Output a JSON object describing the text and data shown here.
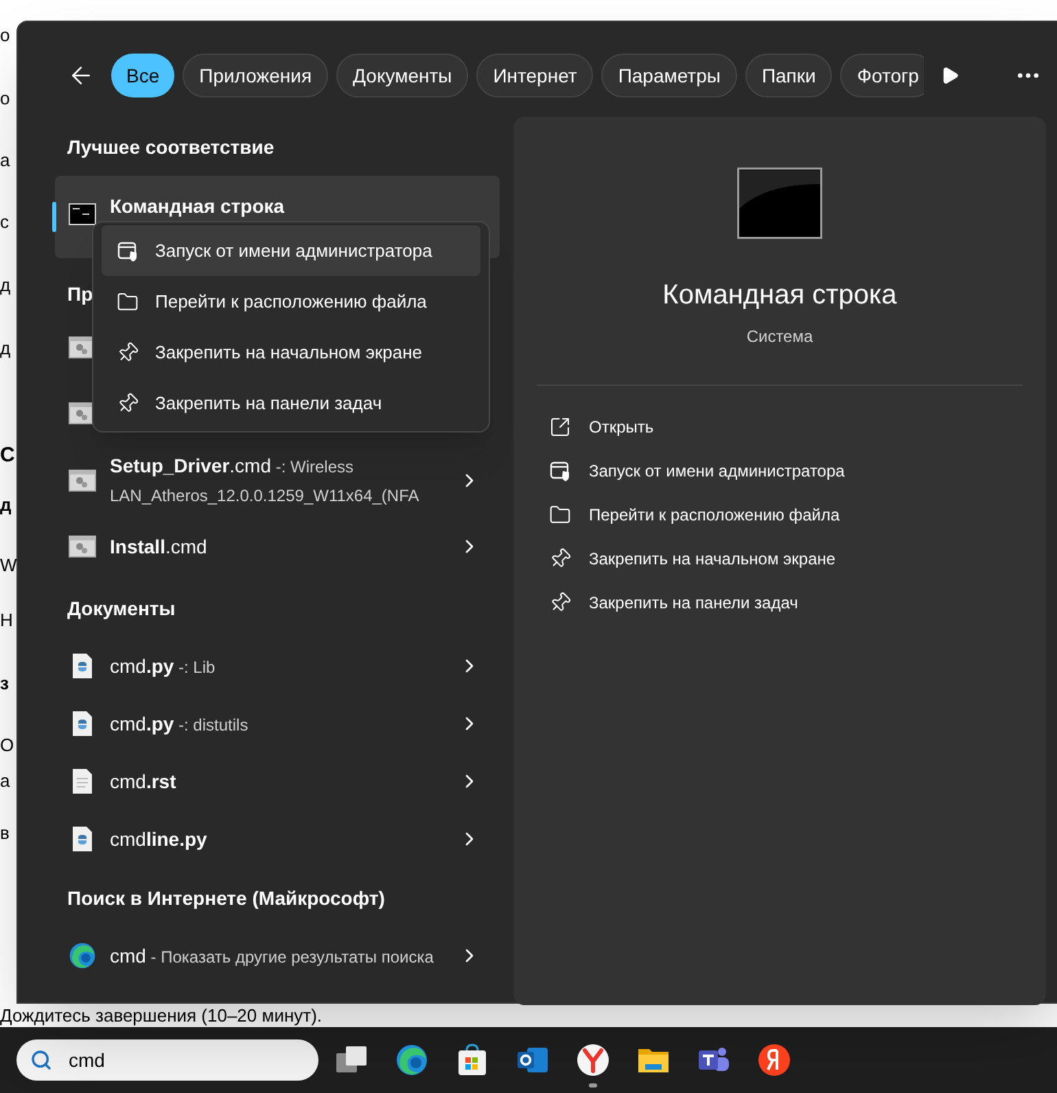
{
  "background_page": {
    "fragments": [
      {
        "text": "о",
        "kind": "plain"
      },
      {
        "text": "о",
        "kind": "plain"
      },
      {
        "text": "а",
        "kind": "plain"
      },
      {
        "text": "с",
        "kind": "plain"
      },
      {
        "text": "д",
        "kind": "plain"
      },
      {
        "text": "д",
        "kind": "plain"
      },
      {
        "text": "С",
        "kind": "heading"
      },
      {
        "text": "д",
        "kind": "bold"
      },
      {
        "text": "W",
        "kind": "plain"
      },
      {
        "text": "H",
        "kind": "plain"
      },
      {
        "text": "з",
        "kind": "bold"
      },
      {
        "text": "О",
        "kind": "plain"
      },
      {
        "text": "а",
        "kind": "plain"
      },
      {
        "text": "в",
        "kind": "plain"
      }
    ],
    "bottom_line": "Дождитесь завершения (10–20 минут)."
  },
  "search_window": {
    "tabs": [
      {
        "label": "Все",
        "selected": true
      },
      {
        "label": "Приложения",
        "selected": false
      },
      {
        "label": "Документы",
        "selected": false
      },
      {
        "label": "Интернет",
        "selected": false
      },
      {
        "label": "Параметры",
        "selected": false
      },
      {
        "label": "Папки",
        "selected": false
      },
      {
        "label": "Фотогр",
        "selected": false
      }
    ],
    "best_match": {
      "heading": "Лучшее соответствие",
      "title": "Командная строка",
      "selected": true
    },
    "apps": {
      "heading": "Пр",
      "rows": [
        {
          "kind": "script"
        },
        {
          "kind": "script"
        },
        {
          "kind": "script",
          "title": "**Setup_Driver**.cmd",
          "detail": "-: Wireless LAN_Atheros_12.0.0.1259_W11x64_(NFA"
        },
        {
          "kind": "script",
          "title": "**Install**.cmd"
        }
      ]
    },
    "documents": {
      "heading": "Документы",
      "rows": [
        {
          "kind": "python",
          "title": "cmd**.py**",
          "detail": "-: Lib"
        },
        {
          "kind": "python",
          "title": "cmd**.py**",
          "detail": "-: distutils"
        },
        {
          "kind": "text",
          "title": "cmd**.rst**"
        },
        {
          "kind": "python",
          "title": "cmd**line.py**"
        }
      ]
    },
    "web": {
      "heading": "Поиск в Интернете (Майкрософт)",
      "rows": [
        {
          "kind": "edge",
          "title": "cmd",
          "detail": "- Показать другие результаты поиска"
        }
      ]
    },
    "context_menu": [
      {
        "kind": "admin",
        "label": "Запуск от имени администратора",
        "selected": true
      },
      {
        "kind": "folder",
        "label": "Перейти к расположению файла",
        "selected": false
      },
      {
        "kind": "pin",
        "label": "Закрепить на начальном экране",
        "selected": false
      },
      {
        "kind": "pin",
        "label": "Закрепить на панели задач",
        "selected": false
      }
    ],
    "preview": {
      "title": "Командная строка",
      "subtitle": "Система",
      "actions": [
        {
          "kind": "open",
          "label": "Открыть"
        },
        {
          "kind": "admin",
          "label": "Запуск от имени администратора"
        },
        {
          "kind": "folder",
          "label": "Перейти к расположению файла"
        },
        {
          "kind": "pin",
          "label": "Закрепить на начальном экране"
        },
        {
          "kind": "pin",
          "label": "Закрепить на панели задач"
        }
      ]
    }
  },
  "taskbar": {
    "search": {
      "value": "cmd"
    },
    "apps": [
      {
        "kind": "taskview",
        "active": false
      },
      {
        "kind": "edge",
        "active": false
      },
      {
        "kind": "store",
        "active": false
      },
      {
        "kind": "outlook",
        "active": false
      },
      {
        "kind": "yabrowser",
        "active": true
      },
      {
        "kind": "explorer",
        "active": false
      },
      {
        "kind": "teams",
        "active": false
      },
      {
        "kind": "yandex",
        "active": false
      }
    ]
  }
}
